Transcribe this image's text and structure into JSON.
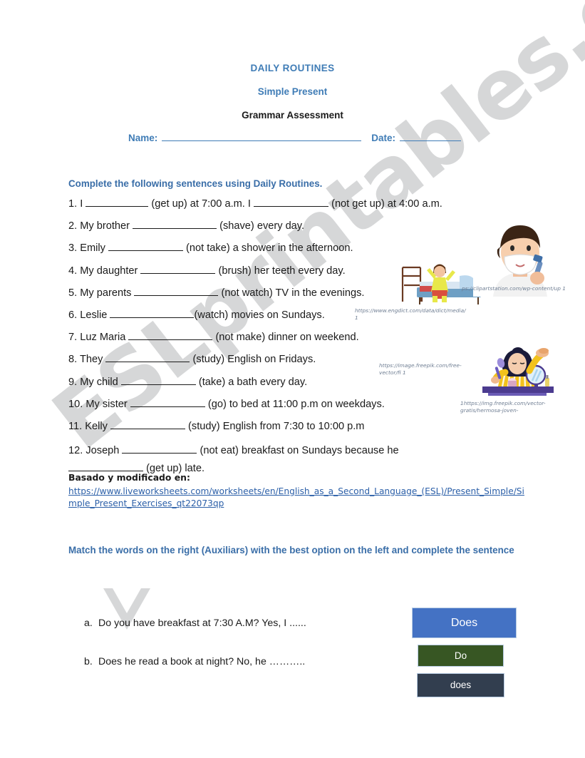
{
  "header": {
    "title": "DAILY ROUTINES",
    "subtitle": "Simple Present",
    "doc_type": "Grammar Assessment",
    "name_label": "Name:",
    "date_label": "Date:",
    "title_color": "#3f7cb6",
    "doc_type_color": "#1a1a1a"
  },
  "section1": {
    "instruction": "Complete the following sentences using Daily Routines.",
    "instruction_color": "#3a6ea8",
    "sentences": [
      {
        "number": "1.",
        "pre": "I",
        "mid": "(get up) at 7:00 a.m. I",
        "post": "(not get up) at 4:00 a.m."
      },
      {
        "number": "2.",
        "pre": "My brother",
        "mid": "",
        "post": "(shave) every day."
      },
      {
        "number": "3.",
        "pre": "Emily",
        "mid": "",
        "post": "(not take) a shower in the afternoon."
      },
      {
        "number": "4.",
        "pre": "My daughter",
        "mid": "",
        "post": "(brush) her teeth every day."
      },
      {
        "number": "5.",
        "pre": "My parents",
        "mid": "",
        "post": "(not watch) TV in the evenings."
      },
      {
        "number": "6.",
        "pre": "Leslie",
        "mid": "",
        "post": "(watch) movies on Sundays."
      },
      {
        "number": "7.",
        "pre": "Luz Maria",
        "mid": "",
        "post": "(not make) dinner on weekend."
      },
      {
        "number": "8.",
        "pre": "They",
        "mid": "",
        "post": "(study) English on Fridays."
      },
      {
        "number": "9.",
        "pre": "My child",
        "mid": "",
        "post": "(take) a bath every day."
      },
      {
        "number": "10.",
        "pre": "My sister",
        "mid": "",
        "post": "(go) to bed at 11:00 p.m on weekdays."
      },
      {
        "number": "11.",
        "pre": "Kelly",
        "mid": "",
        "post": "(study) English from 7:30 to 10:00 p.m"
      },
      {
        "number": "12.",
        "pre": "Joseph",
        "mid": "",
        "post": "(not eat) breakfast on Sundays because he",
        "post2": "(get up) late."
      }
    ]
  },
  "credit": {
    "label": "Basado y modificado en:",
    "url": "https://www.liveworksheets.com/worksheets/en/English_as_a_Second_Language_(ESL)/Present_Simple/Simple_Present_Exercises_qt22073qp",
    "link_color": "#2b5fa8"
  },
  "section2": {
    "instruction": "Match the words on the right (Auxiliars) with the best option on the left and complete the sentence",
    "items": [
      {
        "bullet": "a.",
        "text": "Do you have breakfast at 7:30 A.M? Yes, I ......"
      },
      {
        "bullet": "b.",
        "text": "Does he read a book at night? No, he ……….."
      }
    ],
    "answer_boxes": [
      {
        "label": "Does",
        "color": "#4472c4"
      },
      {
        "label": "Do",
        "color": "#375623"
      },
      {
        "label": "does",
        "color": "#323e4f"
      }
    ]
  },
  "captions": {
    "clipart_station": "ps://clipartstation.com/wp-content/up 1",
    "engdict": "https://www.engdict.com/data/dict/media/ 1",
    "freepik_vector": "https://image.freepik.com/free-vector/fi 1",
    "freepik_img": "1https://img.freepik.com/vector-gratis/hermosa-joven-"
  },
  "watermark": {
    "text": "ESLprintables.com"
  }
}
